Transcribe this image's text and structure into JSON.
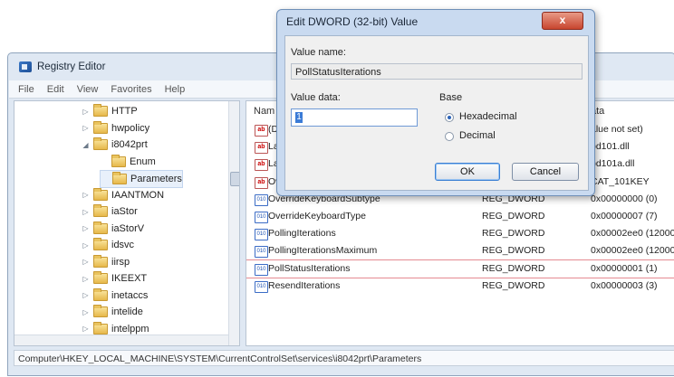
{
  "registry": {
    "title": "Registry Editor",
    "menu": [
      "File",
      "Edit",
      "View",
      "Favorites",
      "Help"
    ],
    "tree": [
      {
        "label": "HTTP",
        "expander": "▷",
        "level": 0
      },
      {
        "label": "hwpolicy",
        "expander": "▷",
        "level": 0
      },
      {
        "label": "i8042prt",
        "expander": "◢",
        "level": 0
      },
      {
        "label": "Enum",
        "expander": "",
        "level": 1
      },
      {
        "label": "Parameters",
        "expander": "",
        "level": 1,
        "selected": true
      },
      {
        "label": "IAANTMON",
        "expander": "▷",
        "level": 0
      },
      {
        "label": "iaStor",
        "expander": "▷",
        "level": 0
      },
      {
        "label": "iaStorV",
        "expander": "▷",
        "level": 0
      },
      {
        "label": "idsvc",
        "expander": "▷",
        "level": 0
      },
      {
        "label": "iirsp",
        "expander": "▷",
        "level": 0
      },
      {
        "label": "IKEEXT",
        "expander": "▷",
        "level": 0
      },
      {
        "label": "inetaccs",
        "expander": "▷",
        "level": 0
      },
      {
        "label": "intelide",
        "expander": "▷",
        "level": 0
      },
      {
        "label": "intelppm",
        "expander": "▷",
        "level": 0
      }
    ],
    "columns": {
      "name": "Nam",
      "type": "",
      "data": "ata"
    },
    "values": [
      {
        "icon": "ab",
        "name": "(D",
        "type": "",
        "data": "alue not set)"
      },
      {
        "icon": "ab",
        "name": "La",
        "type": "",
        "data": "bd101.dll"
      },
      {
        "icon": "ab",
        "name": "La",
        "type": "",
        "data": "bd101a.dll"
      },
      {
        "icon": "ab",
        "name": "Ov",
        "type": "",
        "data": "CAT_101KEY"
      },
      {
        "icon": "bin",
        "name": "OverrideKeyboardSubtype",
        "type": "REG_DWORD",
        "data": "0x00000000 (0)"
      },
      {
        "icon": "bin",
        "name": "OverrideKeyboardType",
        "type": "REG_DWORD",
        "data": "0x00000007 (7)"
      },
      {
        "icon": "bin",
        "name": "PollingIterations",
        "type": "REG_DWORD",
        "data": "0x00002ee0 (12000"
      },
      {
        "icon": "bin",
        "name": "PollingIterationsMaximum",
        "type": "REG_DWORD",
        "data": "0x00002ee0 (12000"
      },
      {
        "icon": "bin",
        "name": "PollStatusIterations",
        "type": "REG_DWORD",
        "data": "0x00000001 (1)"
      },
      {
        "icon": "bin",
        "name": "ResendIterations",
        "type": "REG_DWORD",
        "data": "0x00000003 (3)"
      }
    ],
    "status_path": "Computer\\HKEY_LOCAL_MACHINE\\SYSTEM\\CurrentControlSet\\services\\i8042prt\\Parameters"
  },
  "dialog": {
    "title": "Edit DWORD (32-bit) Value",
    "close_label": "x",
    "value_name_label": "Value name:",
    "value_name": "PollStatusIterations",
    "value_data_label": "Value data:",
    "value_data": "1",
    "base_label": "Base",
    "radio_hex": "Hexadecimal",
    "radio_dec": "Decimal",
    "selected_base": "Hexadecimal",
    "ok_label": "OK",
    "cancel_label": "Cancel"
  }
}
